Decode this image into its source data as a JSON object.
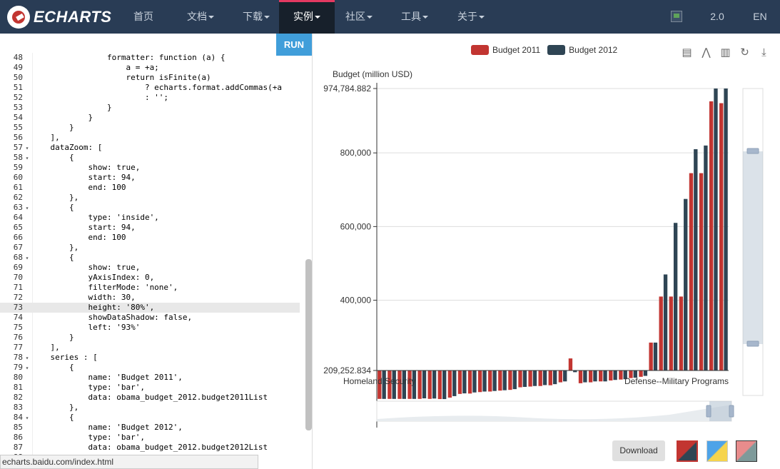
{
  "nav": {
    "logo_text": "ECHARTS",
    "items": [
      {
        "label": "首页",
        "dropdown": false
      },
      {
        "label": "文档",
        "dropdown": true
      },
      {
        "label": "下载",
        "dropdown": true
      },
      {
        "label": "实例",
        "dropdown": true,
        "active": true
      },
      {
        "label": "社区",
        "dropdown": true
      },
      {
        "label": "工具",
        "dropdown": true
      },
      {
        "label": "关于",
        "dropdown": true
      }
    ],
    "version": "2.0",
    "lang": "EN"
  },
  "editor": {
    "run_label": "RUN",
    "status_url": "echarts.baidu.com/index.html",
    "lines": [
      {
        "n": "48",
        "fold": false,
        "text": "                formatter: function (a) {"
      },
      {
        "n": "49",
        "fold": false,
        "text": "                    a = +a;"
      },
      {
        "n": "50",
        "fold": false,
        "text": "                    return isFinite(a)"
      },
      {
        "n": "51",
        "fold": false,
        "text": "                        ? echarts.format.addCommas(+a"
      },
      {
        "n": "52",
        "fold": false,
        "text": "                        : '';"
      },
      {
        "n": "53",
        "fold": false,
        "text": "                }"
      },
      {
        "n": "54",
        "fold": false,
        "text": "            }"
      },
      {
        "n": "55",
        "fold": false,
        "text": "        }"
      },
      {
        "n": "56",
        "fold": false,
        "text": "    ],"
      },
      {
        "n": "57",
        "fold": true,
        "text": "    dataZoom: ["
      },
      {
        "n": "58",
        "fold": true,
        "text": "        {"
      },
      {
        "n": "59",
        "fold": false,
        "text": "            show: true,"
      },
      {
        "n": "60",
        "fold": false,
        "text": "            start: 94,"
      },
      {
        "n": "61",
        "fold": false,
        "text": "            end: 100"
      },
      {
        "n": "62",
        "fold": false,
        "text": "        },"
      },
      {
        "n": "63",
        "fold": true,
        "text": "        {"
      },
      {
        "n": "64",
        "fold": false,
        "text": "            type: 'inside',"
      },
      {
        "n": "65",
        "fold": false,
        "text": "            start: 94,"
      },
      {
        "n": "66",
        "fold": false,
        "text": "            end: 100"
      },
      {
        "n": "67",
        "fold": false,
        "text": "        },"
      },
      {
        "n": "68",
        "fold": true,
        "text": "        {"
      },
      {
        "n": "69",
        "fold": false,
        "text": "            show: true,"
      },
      {
        "n": "70",
        "fold": false,
        "text": "            yAxisIndex: 0,"
      },
      {
        "n": "71",
        "fold": false,
        "text": "            filterMode: 'none',"
      },
      {
        "n": "72",
        "fold": false,
        "text": "            width: 30,"
      },
      {
        "n": "73",
        "fold": false,
        "text": "            height: '80%',",
        "highlight": true
      },
      {
        "n": "74",
        "fold": false,
        "text": "            showDataShadow: false,"
      },
      {
        "n": "75",
        "fold": false,
        "text": "            left: '93%'"
      },
      {
        "n": "76",
        "fold": false,
        "text": "        }"
      },
      {
        "n": "77",
        "fold": false,
        "text": "    ],"
      },
      {
        "n": "78",
        "fold": true,
        "text": "    series : ["
      },
      {
        "n": "79",
        "fold": true,
        "text": "        {"
      },
      {
        "n": "80",
        "fold": false,
        "text": "            name: 'Budget 2011',"
      },
      {
        "n": "81",
        "fold": false,
        "text": "            type: 'bar',"
      },
      {
        "n": "82",
        "fold": false,
        "text": "            data: obama_budget_2012.budget2011List"
      },
      {
        "n": "83",
        "fold": false,
        "text": "        },"
      },
      {
        "n": "84",
        "fold": true,
        "text": "        {"
      },
      {
        "n": "85",
        "fold": false,
        "text": "            name: 'Budget 2012',"
      },
      {
        "n": "86",
        "fold": false,
        "text": "            type: 'bar',"
      },
      {
        "n": "87",
        "fold": false,
        "text": "            data: obama_budget_2012.budget2012List"
      },
      {
        "n": "88",
        "fold": false,
        "text": ""
      }
    ]
  },
  "chart_data": {
    "type": "bar",
    "ylabel": "Budget (million USD)",
    "ylim": [
      209252.834,
      974784.882
    ],
    "y_ticks": [
      "974,784.882",
      "800,000",
      "600,000",
      "400,000",
      "209,252.834"
    ],
    "x_tick_labels": [
      "Homeland Security",
      "Defense--Military Programs"
    ],
    "legend_position": "top",
    "series": [
      {
        "name": "Budget 2011",
        "color": "#c23531",
        "values": [
          55000,
          55000,
          55000,
          55000,
          55000,
          55000,
          54000,
          62000,
          82000,
          84000,
          92000,
          95000,
          100000,
          104000,
          118000,
          122000,
          125000,
          129000,
          145000,
          242000,
          140000,
          145000,
          150000,
          155000,
          160000,
          168000,
          175000,
          285000,
          410000,
          410000,
          410000,
          745000,
          745000,
          940000,
          935000
        ]
      },
      {
        "name": "Budget 2012",
        "color": "#2f4554",
        "values": [
          55000,
          55000,
          55000,
          55000,
          58000,
          57000,
          54000,
          70000,
          85000,
          90000,
          95000,
          98000,
          102000,
          108000,
          120000,
          125000,
          130000,
          135000,
          150000,
          200000,
          145000,
          150000,
          150000,
          158000,
          162000,
          170000,
          180000,
          285000,
          470000,
          610000,
          675000,
          810000,
          820000,
          974784.882,
          974784.882
        ]
      }
    ]
  },
  "chart_ui": {
    "download_label": "Download",
    "tool_icons": [
      "data-view-icon",
      "line-switch-icon",
      "bar-switch-icon",
      "restore-icon",
      "save-image-icon"
    ]
  }
}
